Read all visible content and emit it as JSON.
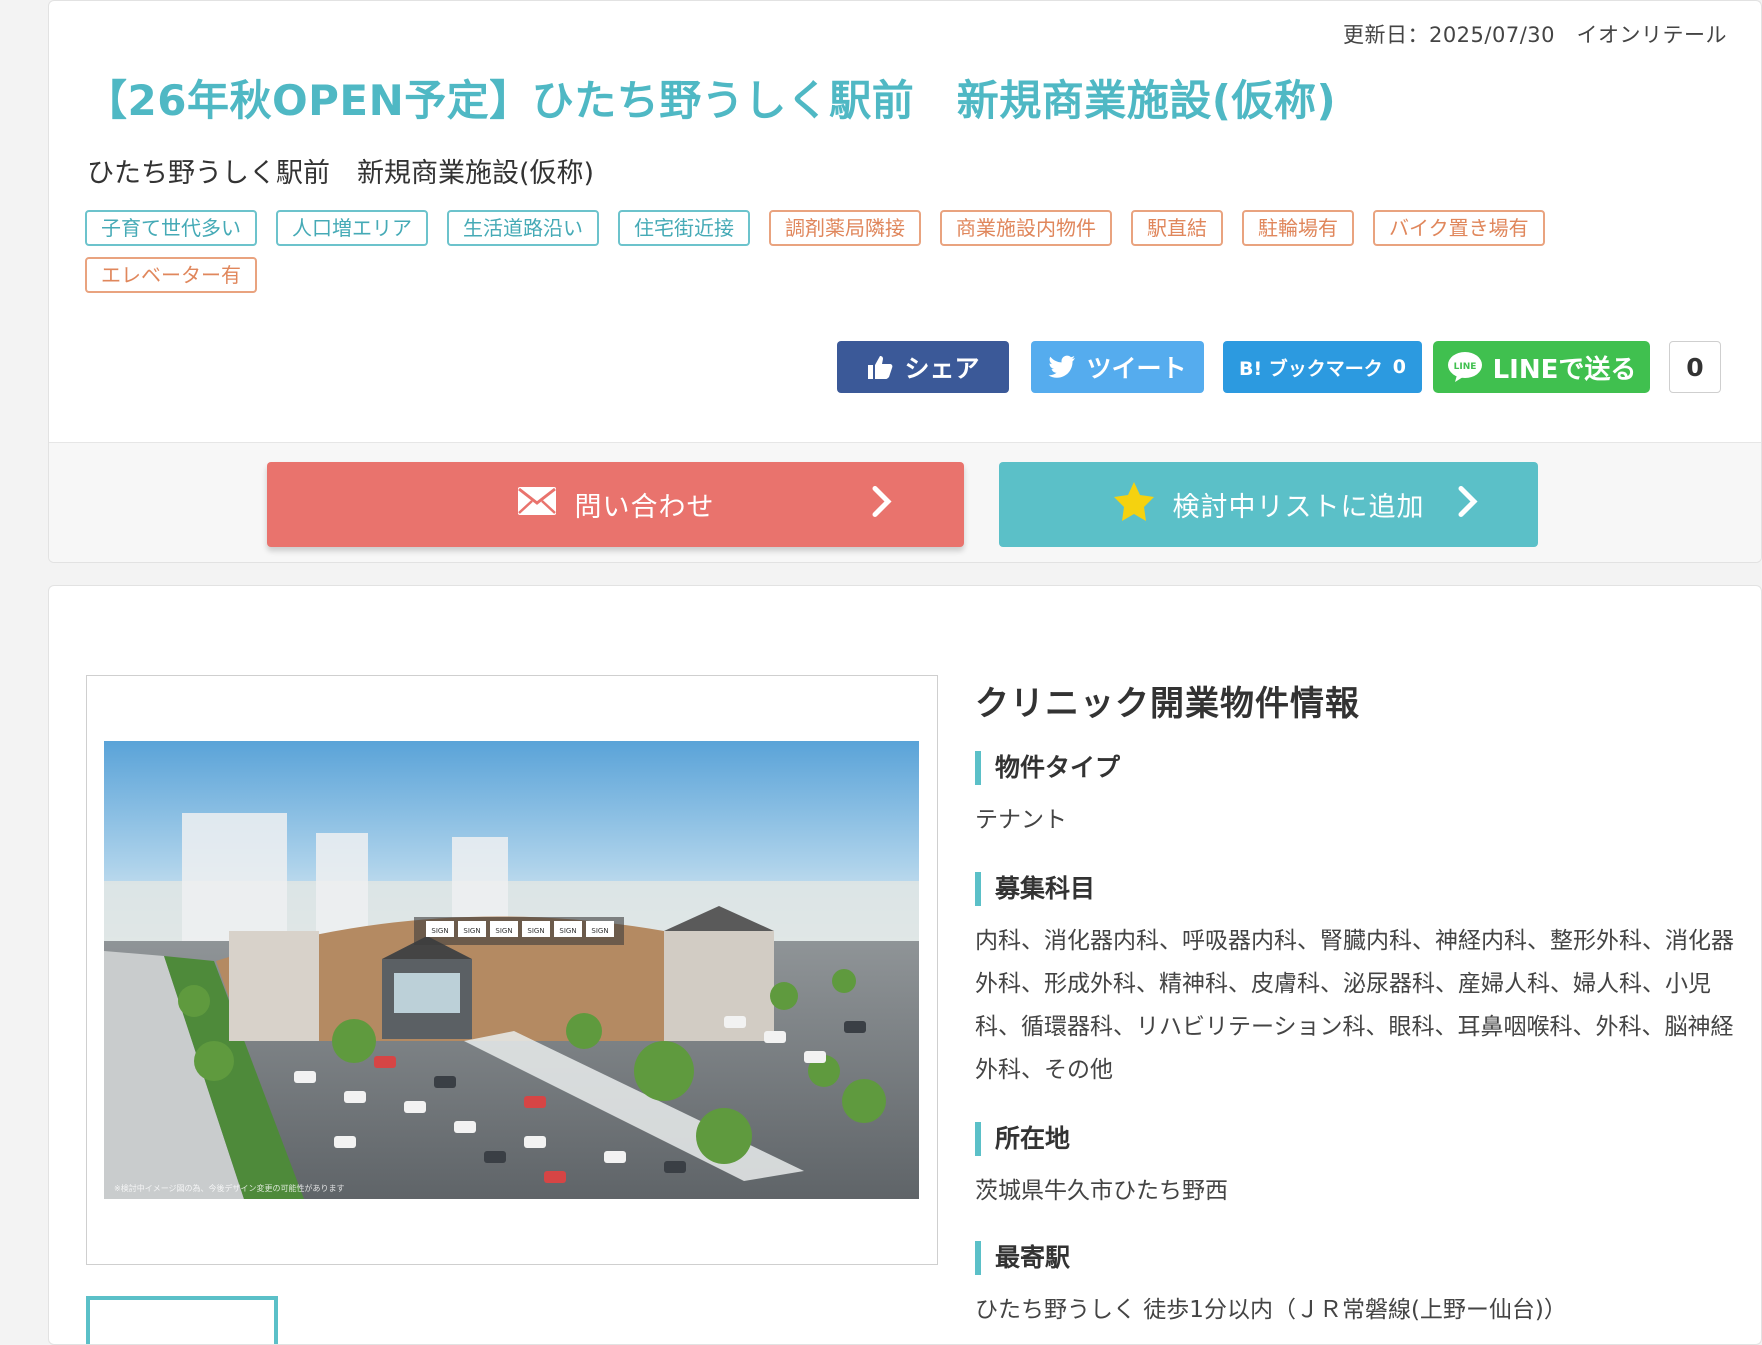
{
  "header": {
    "updated": "更新日：2025/07/30　イオンリテール",
    "title": "【26年秋OPEN予定】ひたち野うしく駅前　新規商業施設(仮称)",
    "subtitle": "ひたち野うしく駅前　新規商業施設(仮称)"
  },
  "tags": [
    {
      "label": "子育て世代多い",
      "color": "teal"
    },
    {
      "label": "人口増エリア",
      "color": "teal"
    },
    {
      "label": "生活道路沿い",
      "color": "teal"
    },
    {
      "label": "住宅街近接",
      "color": "teal"
    },
    {
      "label": "調剤薬局隣接",
      "color": "orange"
    },
    {
      "label": "商業施設内物件",
      "color": "orange"
    },
    {
      "label": "駅直結",
      "color": "orange"
    },
    {
      "label": "駐輪場有",
      "color": "orange"
    },
    {
      "label": "バイク置き場有",
      "color": "orange"
    },
    {
      "label": "エレベーター有",
      "color": "orange"
    }
  ],
  "social": {
    "share": "シェア",
    "tweet": "ツイート",
    "hatena": "B! ブックマーク",
    "hatena_count": "0",
    "line": "LINEで送る",
    "line_badge": "LINE",
    "count": "0"
  },
  "actions": {
    "contact": "問い合わせ",
    "add_list": "検討中リストに追加"
  },
  "info": {
    "heading": "クリニック開業物件情報",
    "sections": [
      {
        "label": "物件タイプ",
        "value": "テナント"
      },
      {
        "label": "募集科目",
        "value": "内科、消化器内科、呼吸器内科、腎臓内科、神経内科、整形外科、消化器外科、形成外科、精神科、皮膚科、泌尿器科、産婦人科、婦人科、小児科、循環器科、リハビリテーション科、眼科、耳鼻咽喉科、外科、脳神経外科、その他"
      },
      {
        "label": "所在地",
        "value": "茨城県牛久市ひたち野西"
      },
      {
        "label": "最寄駅",
        "value": "ひたち野うしく 徒歩1分以内（ＪＲ常磐線(上野ー仙台)）"
      }
    ]
  },
  "photo": {
    "signs": [
      "SIGN",
      "SIGN",
      "SIGN",
      "SIGN",
      "SIGN",
      "SIGN"
    ],
    "caption": "※検討中イメージ図の為、今後デザイン変更の可能性があります"
  },
  "colors": {
    "title": "#4fb8c4",
    "teal": "#5bc0c8",
    "contact": "#e9736d",
    "facebook": "#3b5998",
    "twitter": "#55acee",
    "hatena": "#2c9ae0",
    "line": "#40c04f"
  }
}
